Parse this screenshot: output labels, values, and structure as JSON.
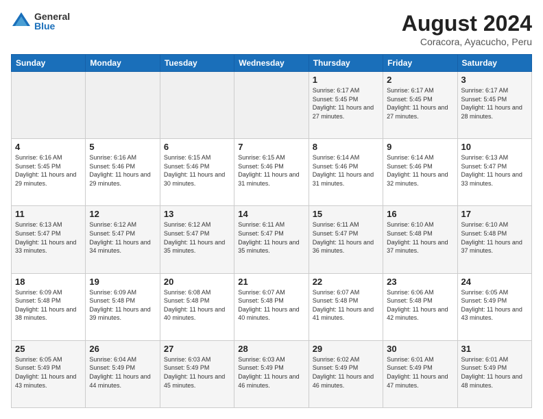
{
  "header": {
    "logo_general": "General",
    "logo_blue": "Blue",
    "title": "August 2024",
    "subtitle": "Coracora, Ayacucho, Peru"
  },
  "days_of_week": [
    "Sunday",
    "Monday",
    "Tuesday",
    "Wednesday",
    "Thursday",
    "Friday",
    "Saturday"
  ],
  "weeks": [
    [
      {
        "day": "",
        "sunrise": "",
        "sunset": "",
        "daylight": ""
      },
      {
        "day": "",
        "sunrise": "",
        "sunset": "",
        "daylight": ""
      },
      {
        "day": "",
        "sunrise": "",
        "sunset": "",
        "daylight": ""
      },
      {
        "day": "",
        "sunrise": "",
        "sunset": "",
        "daylight": ""
      },
      {
        "day": "1",
        "sunrise": "Sunrise: 6:17 AM",
        "sunset": "Sunset: 5:45 PM",
        "daylight": "Daylight: 11 hours and 27 minutes."
      },
      {
        "day": "2",
        "sunrise": "Sunrise: 6:17 AM",
        "sunset": "Sunset: 5:45 PM",
        "daylight": "Daylight: 11 hours and 27 minutes."
      },
      {
        "day": "3",
        "sunrise": "Sunrise: 6:17 AM",
        "sunset": "Sunset: 5:45 PM",
        "daylight": "Daylight: 11 hours and 28 minutes."
      }
    ],
    [
      {
        "day": "4",
        "sunrise": "Sunrise: 6:16 AM",
        "sunset": "Sunset: 5:45 PM",
        "daylight": "Daylight: 11 hours and 29 minutes."
      },
      {
        "day": "5",
        "sunrise": "Sunrise: 6:16 AM",
        "sunset": "Sunset: 5:46 PM",
        "daylight": "Daylight: 11 hours and 29 minutes."
      },
      {
        "day": "6",
        "sunrise": "Sunrise: 6:15 AM",
        "sunset": "Sunset: 5:46 PM",
        "daylight": "Daylight: 11 hours and 30 minutes."
      },
      {
        "day": "7",
        "sunrise": "Sunrise: 6:15 AM",
        "sunset": "Sunset: 5:46 PM",
        "daylight": "Daylight: 11 hours and 31 minutes."
      },
      {
        "day": "8",
        "sunrise": "Sunrise: 6:14 AM",
        "sunset": "Sunset: 5:46 PM",
        "daylight": "Daylight: 11 hours and 31 minutes."
      },
      {
        "day": "9",
        "sunrise": "Sunrise: 6:14 AM",
        "sunset": "Sunset: 5:46 PM",
        "daylight": "Daylight: 11 hours and 32 minutes."
      },
      {
        "day": "10",
        "sunrise": "Sunrise: 6:13 AM",
        "sunset": "Sunset: 5:47 PM",
        "daylight": "Daylight: 11 hours and 33 minutes."
      }
    ],
    [
      {
        "day": "11",
        "sunrise": "Sunrise: 6:13 AM",
        "sunset": "Sunset: 5:47 PM",
        "daylight": "Daylight: 11 hours and 33 minutes."
      },
      {
        "day": "12",
        "sunrise": "Sunrise: 6:12 AM",
        "sunset": "Sunset: 5:47 PM",
        "daylight": "Daylight: 11 hours and 34 minutes."
      },
      {
        "day": "13",
        "sunrise": "Sunrise: 6:12 AM",
        "sunset": "Sunset: 5:47 PM",
        "daylight": "Daylight: 11 hours and 35 minutes."
      },
      {
        "day": "14",
        "sunrise": "Sunrise: 6:11 AM",
        "sunset": "Sunset: 5:47 PM",
        "daylight": "Daylight: 11 hours and 35 minutes."
      },
      {
        "day": "15",
        "sunrise": "Sunrise: 6:11 AM",
        "sunset": "Sunset: 5:47 PM",
        "daylight": "Daylight: 11 hours and 36 minutes."
      },
      {
        "day": "16",
        "sunrise": "Sunrise: 6:10 AM",
        "sunset": "Sunset: 5:48 PM",
        "daylight": "Daylight: 11 hours and 37 minutes."
      },
      {
        "day": "17",
        "sunrise": "Sunrise: 6:10 AM",
        "sunset": "Sunset: 5:48 PM",
        "daylight": "Daylight: 11 hours and 37 minutes."
      }
    ],
    [
      {
        "day": "18",
        "sunrise": "Sunrise: 6:09 AM",
        "sunset": "Sunset: 5:48 PM",
        "daylight": "Daylight: 11 hours and 38 minutes."
      },
      {
        "day": "19",
        "sunrise": "Sunrise: 6:09 AM",
        "sunset": "Sunset: 5:48 PM",
        "daylight": "Daylight: 11 hours and 39 minutes."
      },
      {
        "day": "20",
        "sunrise": "Sunrise: 6:08 AM",
        "sunset": "Sunset: 5:48 PM",
        "daylight": "Daylight: 11 hours and 40 minutes."
      },
      {
        "day": "21",
        "sunrise": "Sunrise: 6:07 AM",
        "sunset": "Sunset: 5:48 PM",
        "daylight": "Daylight: 11 hours and 40 minutes."
      },
      {
        "day": "22",
        "sunrise": "Sunrise: 6:07 AM",
        "sunset": "Sunset: 5:48 PM",
        "daylight": "Daylight: 11 hours and 41 minutes."
      },
      {
        "day": "23",
        "sunrise": "Sunrise: 6:06 AM",
        "sunset": "Sunset: 5:48 PM",
        "daylight": "Daylight: 11 hours and 42 minutes."
      },
      {
        "day": "24",
        "sunrise": "Sunrise: 6:05 AM",
        "sunset": "Sunset: 5:49 PM",
        "daylight": "Daylight: 11 hours and 43 minutes."
      }
    ],
    [
      {
        "day": "25",
        "sunrise": "Sunrise: 6:05 AM",
        "sunset": "Sunset: 5:49 PM",
        "daylight": "Daylight: 11 hours and 43 minutes."
      },
      {
        "day": "26",
        "sunrise": "Sunrise: 6:04 AM",
        "sunset": "Sunset: 5:49 PM",
        "daylight": "Daylight: 11 hours and 44 minutes."
      },
      {
        "day": "27",
        "sunrise": "Sunrise: 6:03 AM",
        "sunset": "Sunset: 5:49 PM",
        "daylight": "Daylight: 11 hours and 45 minutes."
      },
      {
        "day": "28",
        "sunrise": "Sunrise: 6:03 AM",
        "sunset": "Sunset: 5:49 PM",
        "daylight": "Daylight: 11 hours and 46 minutes."
      },
      {
        "day": "29",
        "sunrise": "Sunrise: 6:02 AM",
        "sunset": "Sunset: 5:49 PM",
        "daylight": "Daylight: 11 hours and 46 minutes."
      },
      {
        "day": "30",
        "sunrise": "Sunrise: 6:01 AM",
        "sunset": "Sunset: 5:49 PM",
        "daylight": "Daylight: 11 hours and 47 minutes."
      },
      {
        "day": "31",
        "sunrise": "Sunrise: 6:01 AM",
        "sunset": "Sunset: 5:49 PM",
        "daylight": "Daylight: 11 hours and 48 minutes."
      }
    ]
  ]
}
